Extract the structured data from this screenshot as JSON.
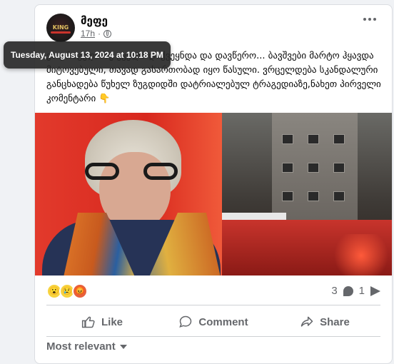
{
  "post": {
    "author": "მეფე",
    "time": "17h",
    "tooltip": "Tuesday, August 13, 2024 at 10:18 PM",
    "text": "ეს ტრაგედიაზე ყველა დაქვეყნდა და დავწერო... ბავშვები მარტო ჰყავდა მიტოვებული, თავად გასართობად იყო წასული. ვრცელდება სკანდალური განცხადება წუხელ ზუგდიდში დატრიალებულ ტრაგედიაზე,ნახეთ პირველი კომენტარი 👇",
    "avatar_text": "KING",
    "reactions": [
      "😮",
      "😢",
      "😡"
    ],
    "comments_count": "3",
    "shares_count": "1"
  },
  "actions": {
    "like": "Like",
    "comment": "Comment",
    "share": "Share"
  },
  "sort_label": "Most relevant",
  "colors": {
    "accent": "#65676b",
    "photo_red": "#e23a2c"
  }
}
